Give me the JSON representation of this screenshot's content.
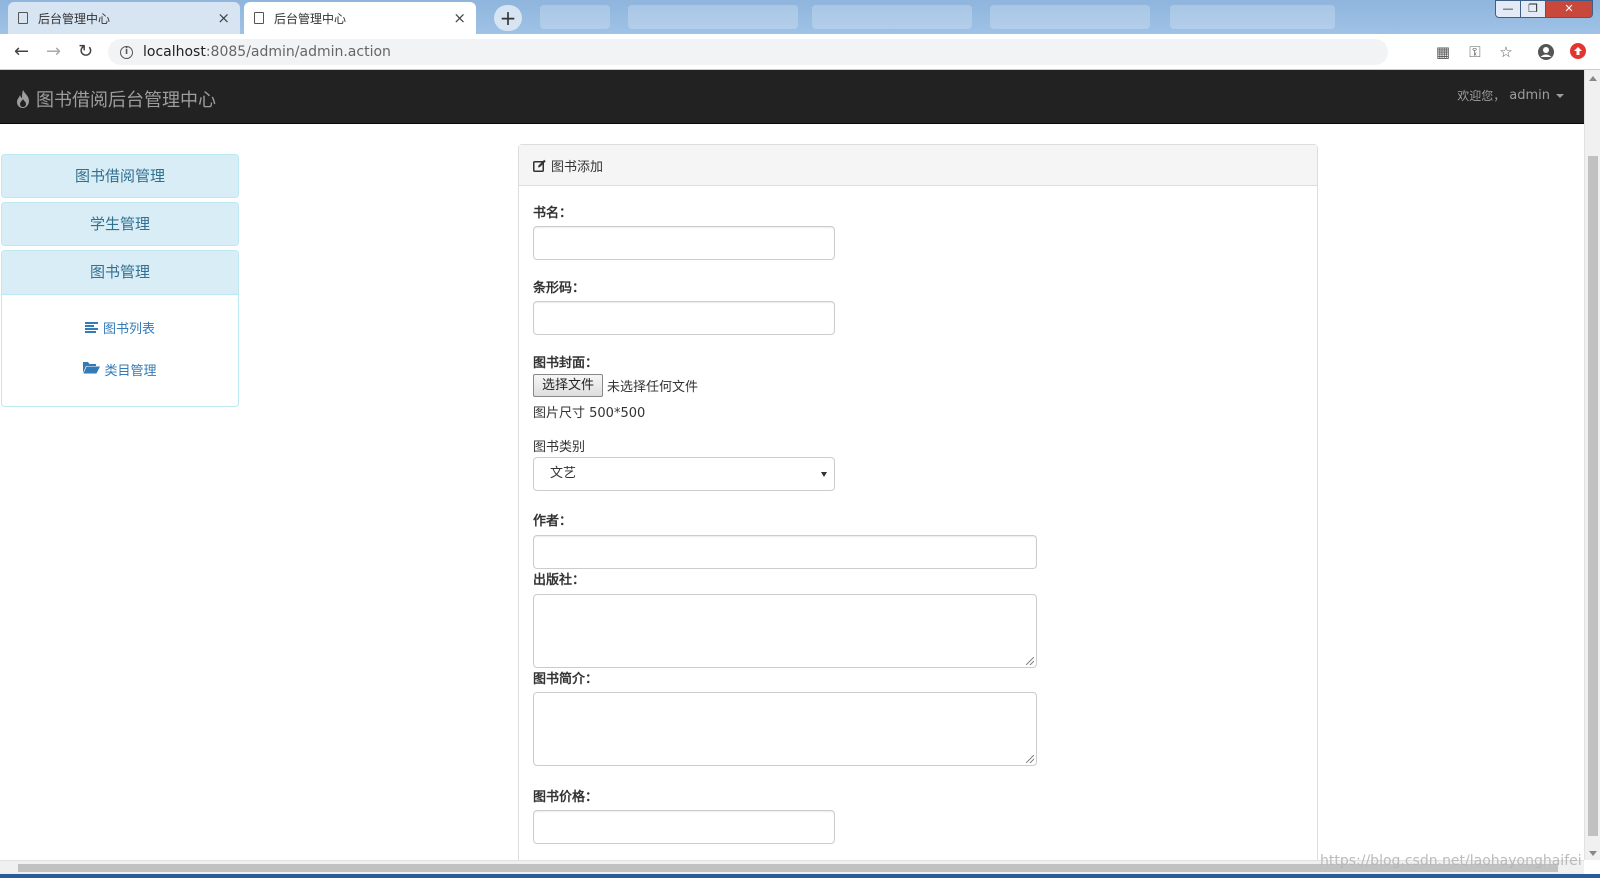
{
  "browser": {
    "tabs": [
      {
        "title": "后台管理中心",
        "active": false
      },
      {
        "title": "后台管理中心",
        "active": true
      }
    ],
    "new_tab_label": "+",
    "close_glyph": "×",
    "url_host": "localhost",
    "url_rest": ":8085/admin/admin.action",
    "window_controls": {
      "min": "—",
      "max": "❐",
      "close": "✕"
    }
  },
  "navbar": {
    "brand": "图书借阅后台管理中心",
    "welcome": "欢迎您，",
    "username": "admin"
  },
  "sidebar": {
    "menus": [
      {
        "label": "图书借阅管理"
      },
      {
        "label": "学生管理"
      },
      {
        "label": "图书管理"
      }
    ],
    "book_submenu": [
      {
        "label": "图书列表",
        "icon": "list-icon"
      },
      {
        "label": "类目管理",
        "icon": "folder-open-icon"
      }
    ]
  },
  "panel": {
    "title": "图书添加",
    "fields": {
      "book_name_label": "书名：",
      "barcode_label": "条形码：",
      "cover_label": "图书封面：",
      "file_button": "选择文件",
      "file_status": "未选择任何文件",
      "size_hint": "图片尺寸 500*500",
      "category_label": "图书类别",
      "category_selected": "文艺",
      "author_label": "作者：",
      "publisher_label": "出版社：",
      "intro_label": "图书简介：",
      "price_label": "图书价格："
    }
  },
  "watermark": "https://blog.csdn.net/laohayonghaifei",
  "colors": {
    "navbar_bg": "#222222",
    "sidebar_head_bg": "#d9edf7",
    "sidebar_text": "#31708f",
    "link": "#337ab7"
  }
}
